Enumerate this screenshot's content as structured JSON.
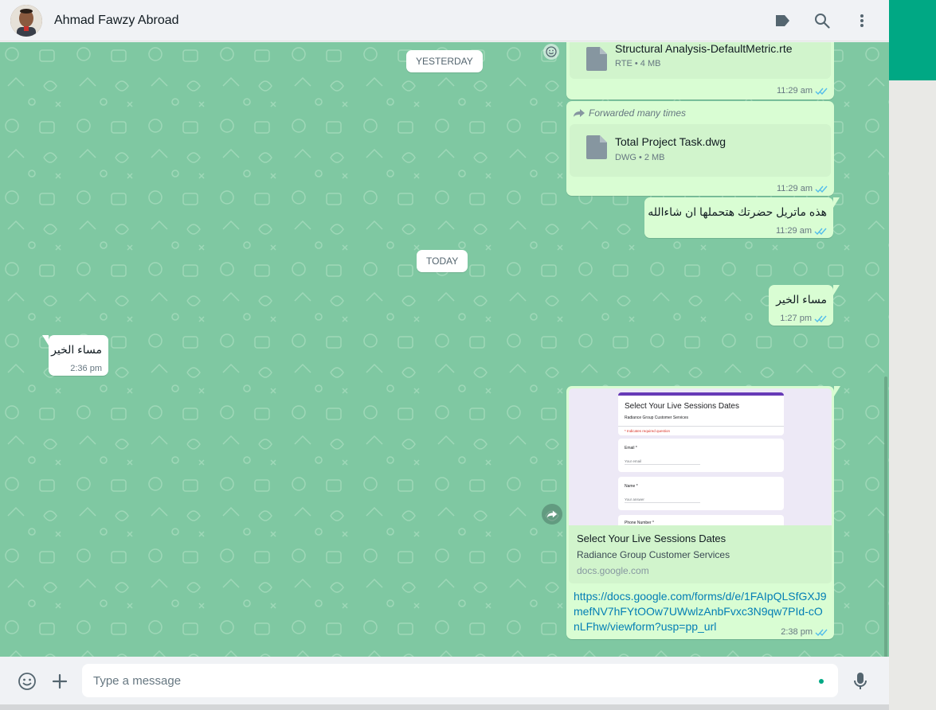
{
  "header": {
    "contact_name": "Ahmad Fawzy Abroad"
  },
  "colors": {
    "accent": "#00a884",
    "chat_bg": "#7fc8a2",
    "outgoing_bubble": "#d9fdd3",
    "incoming_bubble": "#ffffff",
    "read_ticks": "#53bdeb"
  },
  "icons": {
    "header": [
      "label-icon",
      "search-icon",
      "menu-dots-icon"
    ],
    "footer": [
      "emoji-icon",
      "attach-plus-icon",
      "microphone-icon"
    ]
  },
  "dates": {
    "yesterday": "YESTERDAY",
    "today": "TODAY"
  },
  "messages": {
    "doc1": {
      "name": "Structural Analysis-DefaultMetric.rte",
      "meta": "RTE • 4 MB",
      "time": "11:29 am"
    },
    "doc2": {
      "forwarded": "Forwarded many times",
      "name": "Total Project Task.dwg",
      "meta": "DWG • 2 MB",
      "time": "11:29 am"
    },
    "text1": {
      "text": "هذه ماتريل حضرتك هتحملها ان شاءالله",
      "time": "11:29 am"
    },
    "text2": {
      "text": "مساء الخير",
      "time": "1:27 pm"
    },
    "incoming1": {
      "text": "مساء الخير",
      "time": "2:36 pm"
    },
    "link": {
      "preview_form_title": "Select Your Live Sessions Dates",
      "preview_form_sub": "Radiance Group Customer Services",
      "preview_required": "* Indicates required question",
      "preview_q1": "Email *",
      "preview_q1_ph": "Your email",
      "preview_q2": "Name *",
      "preview_q2_ph": "Your answer",
      "preview_q3": "Phone Number *",
      "title": "Select Your Live Sessions Dates",
      "description": "Radiance Group Customer Services",
      "domain": "docs.google.com",
      "url": "https://docs.google.com/forms/d/e/1FAIpQLSfGXJ9mefNV7hFYtOOw7UWwlzAnbFvxc3N9qw7PId-cOnLFhw/viewform?usp=pp_url",
      "time": "2:38 pm"
    }
  },
  "footer": {
    "placeholder": "Type a message"
  }
}
